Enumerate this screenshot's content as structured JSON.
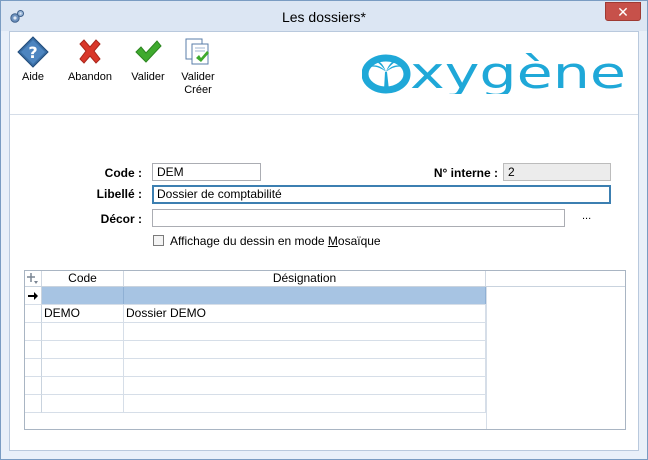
{
  "window": {
    "title": "Les dossiers*",
    "close_symbol": "✕"
  },
  "toolbar": {
    "aide": {
      "label": "Aide",
      "icon": "help-diamond-icon",
      "color": "#3a6ea5"
    },
    "abandon": {
      "label": "Abandon",
      "icon": "red-x-icon",
      "color": "#d9372a"
    },
    "valider": {
      "label": "Valider",
      "icon": "green-check-icon",
      "color": "#3faa2e"
    },
    "valider_creer": {
      "label_line1": "Valider",
      "label_line2": "Créer",
      "icon": "document-check-icon"
    }
  },
  "logo": {
    "text": "oxygène",
    "color": "#1fa8d8"
  },
  "form": {
    "code_label": "Code :",
    "code_value": "DEM",
    "num_interne_label": "N° interne :",
    "num_interne_value": "2",
    "libelle_label": "Libellé :",
    "libelle_value": "Dossier de comptabilité",
    "decor_label": "Décor :",
    "decor_value": "",
    "decor_browse": "...",
    "mosaic_label_before": "Affichage du dessin en mode ",
    "mosaic_label_underlined": "M",
    "mosaic_label_after": "osaïque",
    "mosaic_checked": false
  },
  "grid": {
    "columns": [
      "Code",
      "Désignation"
    ],
    "rows": [
      {
        "code": "",
        "designation": "",
        "current": true
      },
      {
        "code": "DEMO",
        "designation": "Dossier DEMO",
        "current": false
      },
      {
        "code": "",
        "designation": "",
        "current": false
      },
      {
        "code": "",
        "designation": "",
        "current": false
      },
      {
        "code": "",
        "designation": "",
        "current": false
      },
      {
        "code": "",
        "designation": "",
        "current": false
      },
      {
        "code": "",
        "designation": "",
        "current": false
      }
    ],
    "selection_color": "#a7c4e3"
  }
}
